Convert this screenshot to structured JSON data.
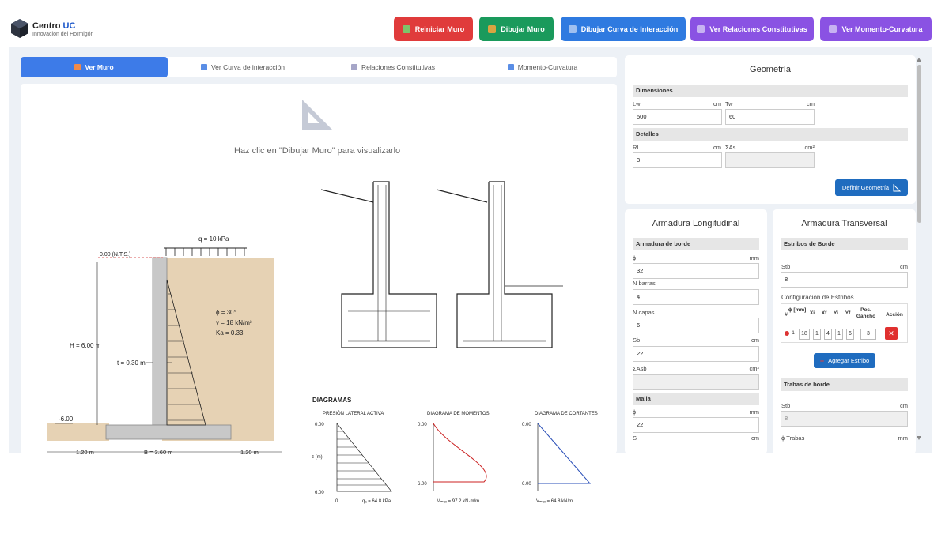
{
  "header": {
    "brand_name": "Centro",
    "brand_uc": "UC",
    "brand_sub": "Innovación del Hormigón",
    "buttons": {
      "reset": "Reiniciar Muro",
      "draw": "Dibujar Muro",
      "curve": "Dibujar Curva de Interacción",
      "relations": "Ver Relaciones Constitutivas",
      "moment": "Ver Momento-Curvatura"
    },
    "colors": {
      "reset": "#e03b3b",
      "draw": "#1a9a5c",
      "curve": "#2f7ae0",
      "relations": "#8a52e3",
      "moment": "#8a52e3"
    }
  },
  "tabs": [
    {
      "label": "Ver Muro",
      "active": true
    },
    {
      "label": "Ver Curva de interacción",
      "active": false
    },
    {
      "label": "Relaciones Constitutivas",
      "active": false
    },
    {
      "label": "Momento-Curvatura",
      "active": false
    }
  ],
  "canvas": {
    "placeholder": "Haz clic en \"Dibujar Muro\" para visualizarlo"
  },
  "wall_figure": {
    "q": "q = 10 kPa",
    "nts": "0.00 (N.T.S.)",
    "H": "H = 6.00 m",
    "t": "t = 0.30 m",
    "phi": "ϕ = 30°",
    "gamma": "γ = 18 kN/m³",
    "ka": "Ka = 0.33",
    "depth": "-6.00",
    "b1": "1.20 m",
    "B": "B = 3.60 m",
    "b2": "1.20 m"
  },
  "diagrams": {
    "title": "DIAGRAMAS",
    "pressure": {
      "title": "PRESIÓN LATERAL ACTIVA",
      "top": "0.00",
      "bottom": "6.00",
      "axis": "z (m)",
      "zero": "0",
      "max_label": "qₐ = 64.8 kPa"
    },
    "moment": {
      "title": "DIAGRAMA DE MOMENTOS",
      "top": "0.00",
      "bottom": "6.00",
      "max_label": "Mₘₐₓ = 97.2 kN·m/m"
    },
    "shear": {
      "title": "DIAGRAMA DE CORTANTES",
      "top": "0.00",
      "bottom": "6.00",
      "max_label": "Vₘₐₓ = 64.8 kN/m"
    }
  },
  "geometry": {
    "title": "Geometría",
    "dimensions": "Dimensiones",
    "lw_label": "Lw",
    "lw_unit": "cm",
    "lw_value": "500",
    "tw_label": "Tw",
    "tw_unit": "cm",
    "tw_value": "60",
    "details": "Detalles",
    "rl_label": "RL",
    "rl_unit": "cm",
    "rl_value": "3",
    "sumas_label": "ΣAs",
    "sumas_unit": "cm²",
    "sumas_value": "",
    "define_button": "Definir Geometría"
  },
  "longitudinal": {
    "title": "Armadura Longitudinal",
    "edge": "Armadura de borde",
    "phi_label": "ϕ",
    "phi_unit": "mm",
    "phi_value": "32",
    "nbars_label": "N barras",
    "nbars_value": "4",
    "nlayers_label": "N capas",
    "nlayers_value": "6",
    "sb_label": "Sb",
    "sb_unit": "cm",
    "sb_value": "22",
    "sumasb_label": "ΣAsb",
    "sumasb_unit": "cm²",
    "sumasb_value": "",
    "mesh": "Malla",
    "mphi_label": "ϕ",
    "mphi_unit": "mm",
    "mphi_value": "22",
    "s_label": "S",
    "s_unit": "cm"
  },
  "transversal": {
    "title": "Armadura Transversal",
    "edge_stirrups": "Estribos de Borde",
    "stb_label": "Stb",
    "stb_unit": "cm",
    "stb_value": "8",
    "config": "Configuración de Estribos",
    "headers": [
      "#",
      "ϕ [mm]",
      "Xi",
      "Xf",
      "Yi",
      "Yf",
      "Pos. Gancho",
      "Acción"
    ],
    "row": {
      "n": "1",
      "phi": "18",
      "xi": "1",
      "xf": "4",
      "yi": "1",
      "yf": "6",
      "hook": "3"
    },
    "add_button": "Agregar Estribo",
    "edge_ties": "Trabas de borde",
    "stt_label": "Stb",
    "stt_unit": "cm",
    "stt_value": "8",
    "tie_phi_label": "ϕ Trabas",
    "tie_phi_unit": "mm"
  }
}
